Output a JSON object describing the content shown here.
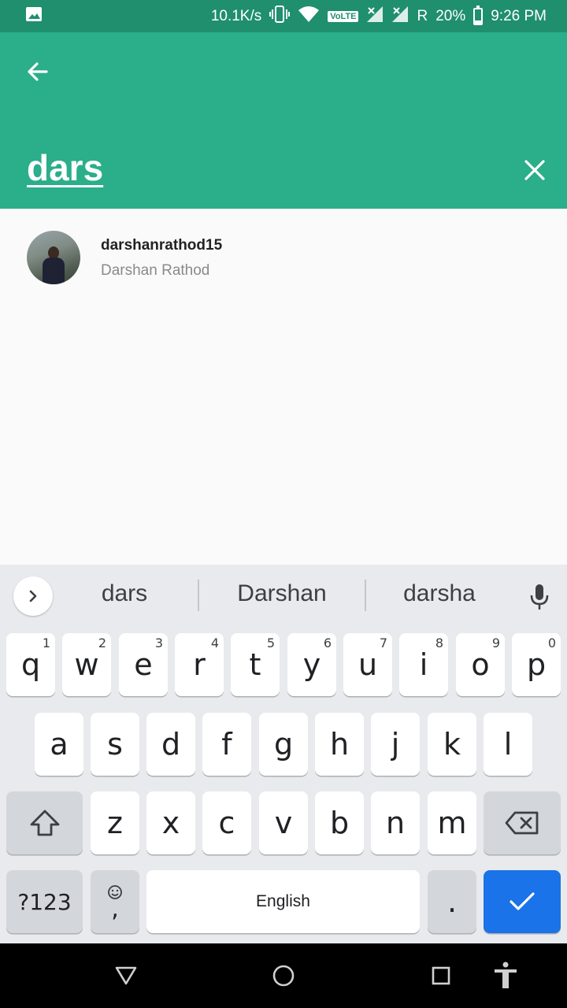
{
  "status_bar": {
    "speed": "10.1K/s",
    "network_badge": "VoLTE",
    "roaming": "R",
    "battery": "20%",
    "battery_level": 0.2,
    "time": "9:26 PM"
  },
  "app_bar": {
    "search_query": "dars"
  },
  "results": [
    {
      "username": "darshanrathod15",
      "full_name": "Darshan Rathod"
    }
  ],
  "keyboard": {
    "suggestions": [
      "dars",
      "Darshan",
      "darsha"
    ],
    "row1": [
      {
        "label": "q",
        "hint": "1"
      },
      {
        "label": "w",
        "hint": "2"
      },
      {
        "label": "e",
        "hint": "3"
      },
      {
        "label": "r",
        "hint": "4"
      },
      {
        "label": "t",
        "hint": "5"
      },
      {
        "label": "y",
        "hint": "6"
      },
      {
        "label": "u",
        "hint": "7"
      },
      {
        "label": "i",
        "hint": "8"
      },
      {
        "label": "o",
        "hint": "9"
      },
      {
        "label": "p",
        "hint": "0"
      }
    ],
    "row2": [
      "a",
      "s",
      "d",
      "f",
      "g",
      "h",
      "j",
      "k",
      "l"
    ],
    "row3": [
      "z",
      "x",
      "c",
      "v",
      "b",
      "n",
      "m"
    ],
    "symbols_key": "?123",
    "comma_key": ",",
    "space_label": "English",
    "period_key": ".",
    "accent_color": "#1a73e8"
  },
  "colors": {
    "app_bar": "#2bae8a",
    "status_bar": "#1f8f6d"
  },
  "icons": {
    "back": "arrow-left-icon",
    "clear": "close-icon",
    "expand": "chevron-right-icon",
    "mic": "microphone-icon",
    "shift": "shift-icon",
    "backspace": "backspace-icon",
    "emoji": "emoji-icon",
    "enter": "checkmark-icon"
  }
}
